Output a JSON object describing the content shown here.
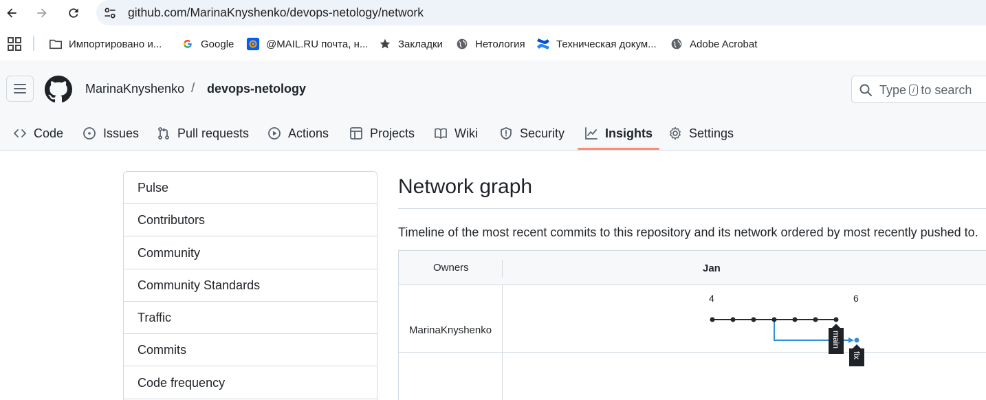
{
  "browser": {
    "url": "github.com/MarinaKnyshenko/devops-netology/network",
    "bookmarks": [
      {
        "label": "Импортировано и...",
        "icon": "folder-icon"
      },
      {
        "label": "Google",
        "icon": "google-icon"
      },
      {
        "label": "@MAIL.RU почта, н...",
        "icon": "mailru-icon"
      },
      {
        "label": "Закладки",
        "icon": "star-icon"
      },
      {
        "label": "Нетология",
        "icon": "globe-icon"
      },
      {
        "label": "Техническая докум...",
        "icon": "confluence-icon"
      },
      {
        "label": "Adobe Acrobat",
        "icon": "globe-icon"
      }
    ]
  },
  "header": {
    "owner": "MarinaKnyshenko",
    "separator": "/",
    "repo": "devops-netology",
    "search": {
      "before": "Type",
      "key": "/",
      "after": "to search"
    }
  },
  "tabs": [
    {
      "label": "Code",
      "icon": "code-icon"
    },
    {
      "label": "Issues",
      "icon": "issue-icon"
    },
    {
      "label": "Pull requests",
      "icon": "pull-request-icon"
    },
    {
      "label": "Actions",
      "icon": "play-icon"
    },
    {
      "label": "Projects",
      "icon": "table-icon"
    },
    {
      "label": "Wiki",
      "icon": "book-icon"
    },
    {
      "label": "Security",
      "icon": "shield-icon"
    },
    {
      "label": "Insights",
      "icon": "graph-icon",
      "active": true
    },
    {
      "label": "Settings",
      "icon": "gear-icon"
    }
  ],
  "sidebar": {
    "items": [
      "Pulse",
      "Contributors",
      "Community",
      "Community Standards",
      "Traffic",
      "Commits",
      "Code frequency"
    ]
  },
  "main": {
    "title": "Network graph",
    "description": "Timeline of the most recent commits to this repository and its network ordered by most recently pushed to."
  },
  "network": {
    "owners_header": "Owners",
    "month": "Jan",
    "owner": "MarinaKnyshenko",
    "days": [
      "4",
      "6"
    ],
    "branches": [
      {
        "name": "main",
        "color": "#24292f",
        "commits": 7
      },
      {
        "name": "fix",
        "color": "#2f8fdd",
        "commits": 1
      }
    ]
  },
  "colors": {
    "accent_underline": "#fd8c73",
    "branch_main": "#24292f",
    "branch_fix": "#2f8fdd"
  }
}
